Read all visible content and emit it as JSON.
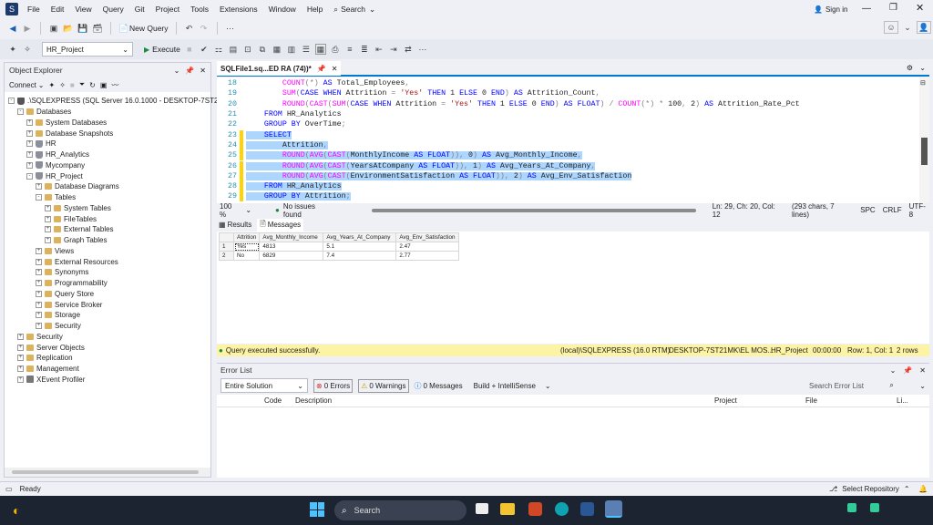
{
  "menu": {
    "items": [
      "File",
      "Edit",
      "View",
      "Query",
      "Git",
      "Project",
      "Tools",
      "Extensions",
      "Window",
      "Help"
    ],
    "search_label": "Search",
    "sign_in": "Sign in"
  },
  "toolbar": {
    "new_query": "New Query",
    "database": "HR_Project",
    "execute": "Execute"
  },
  "object_explorer": {
    "title": "Object Explorer",
    "connect": "Connect",
    "tree": [
      {
        "label": ".\\SQLEXPRESS (SQL Server 16.0.1000 - DESKTOP-7ST21MK",
        "indent": 0,
        "exp": "-",
        "icon": "server"
      },
      {
        "label": "Databases",
        "indent": 1,
        "exp": "-",
        "icon": "folder"
      },
      {
        "label": "System Databases",
        "indent": 2,
        "exp": "+",
        "icon": "folder"
      },
      {
        "label": "Database Snapshots",
        "indent": 2,
        "exp": "+",
        "icon": "folder"
      },
      {
        "label": "HR",
        "indent": 2,
        "exp": "+",
        "icon": "db"
      },
      {
        "label": "HR_Analytics",
        "indent": 2,
        "exp": "+",
        "icon": "db"
      },
      {
        "label": "Mycompany",
        "indent": 2,
        "exp": "+",
        "icon": "db"
      },
      {
        "label": "HR_Project",
        "indent": 2,
        "exp": "-",
        "icon": "db"
      },
      {
        "label": "Database Diagrams",
        "indent": 3,
        "exp": "+",
        "icon": "folder"
      },
      {
        "label": "Tables",
        "indent": 3,
        "exp": "-",
        "icon": "folder"
      },
      {
        "label": "System Tables",
        "indent": 4,
        "exp": "+",
        "icon": "folder"
      },
      {
        "label": "FileTables",
        "indent": 4,
        "exp": "+",
        "icon": "folder"
      },
      {
        "label": "External Tables",
        "indent": 4,
        "exp": "+",
        "icon": "folder"
      },
      {
        "label": "Graph Tables",
        "indent": 4,
        "exp": "+",
        "icon": "folder"
      },
      {
        "label": "Views",
        "indent": 3,
        "exp": "+",
        "icon": "folder"
      },
      {
        "label": "External Resources",
        "indent": 3,
        "exp": "+",
        "icon": "folder"
      },
      {
        "label": "Synonyms",
        "indent": 3,
        "exp": "+",
        "icon": "folder"
      },
      {
        "label": "Programmability",
        "indent": 3,
        "exp": "+",
        "icon": "folder"
      },
      {
        "label": "Query Store",
        "indent": 3,
        "exp": "+",
        "icon": "folder"
      },
      {
        "label": "Service Broker",
        "indent": 3,
        "exp": "+",
        "icon": "folder"
      },
      {
        "label": "Storage",
        "indent": 3,
        "exp": "+",
        "icon": "folder"
      },
      {
        "label": "Security",
        "indent": 3,
        "exp": "+",
        "icon": "folder"
      },
      {
        "label": "Security",
        "indent": 1,
        "exp": "+",
        "icon": "folder"
      },
      {
        "label": "Server Objects",
        "indent": 1,
        "exp": "+",
        "icon": "folder"
      },
      {
        "label": "Replication",
        "indent": 1,
        "exp": "+",
        "icon": "folder"
      },
      {
        "label": "Management",
        "indent": 1,
        "exp": "+",
        "icon": "folder"
      },
      {
        "label": "XEvent Profiler",
        "indent": 1,
        "exp": "+",
        "icon": "xevent"
      }
    ]
  },
  "editor": {
    "tab_title": "SQLFile1.sq...ED RA (74))*",
    "lines": [
      {
        "n": "18",
        "sel": false,
        "html": "        <span class=\"fn\">COUNT</span><span class=\"gy\">(*)</span> <span class=\"kw\">AS</span> Total_Employees<span class=\"gy\">,</span>"
      },
      {
        "n": "19",
        "sel": false,
        "html": "        <span class=\"fn\">SUM</span><span class=\"gy\">(</span><span class=\"kw\">CASE WHEN</span> Attrition <span class=\"gy\">=</span> <span class=\"str\">'Yes'</span> <span class=\"kw\">THEN</span> 1 <span class=\"kw\">ELSE</span> 0 <span class=\"kw\">END</span><span class=\"gy\">)</span> <span class=\"kw\">AS</span> Attrition_Count<span class=\"gy\">,</span>"
      },
      {
        "n": "20",
        "sel": false,
        "html": "        <span class=\"fn\">ROUND</span><span class=\"gy\">(</span><span class=\"fn\">CAST</span><span class=\"gy\">(</span><span class=\"fn\">SUM</span><span class=\"gy\">(</span><span class=\"kw\">CASE WHEN</span> Attrition <span class=\"gy\">=</span> <span class=\"str\">'Yes'</span> <span class=\"kw\">THEN</span> 1 <span class=\"kw\">ELSE</span> 0 <span class=\"kw\">END</span><span class=\"gy\">)</span> <span class=\"kw\">AS FLOAT</span><span class=\"gy\">)</span> <span class=\"gy\">/</span> <span class=\"fn\">COUNT</span><span class=\"gy\">(*)</span> <span class=\"gy\">*</span> 100<span class=\"gy\">,</span> 2<span class=\"gy\">)</span> <span class=\"kw\">AS</span> Attrition_Rate_Pct"
      },
      {
        "n": "21",
        "sel": false,
        "html": "    <span class=\"kw\">FROM</span> HR_Analytics"
      },
      {
        "n": "22",
        "sel": false,
        "html": "    <span class=\"kw\">GROUP BY</span> OverTime<span class=\"gy\">;</span>"
      },
      {
        "n": "23",
        "sel": true,
        "html": "    <span class=\"kw\">SELECT</span>"
      },
      {
        "n": "24",
        "sel": true,
        "html": "        Attrition<span class=\"gy\">,</span>"
      },
      {
        "n": "25",
        "sel": true,
        "html": "        <span class=\"fn\">ROUND</span><span class=\"gy\">(</span><span class=\"fn\">AVG</span><span class=\"gy\">(</span><span class=\"fn\">CAST</span><span class=\"gy\">(</span>MonthlyIncome <span class=\"kw\">AS FLOAT</span><span class=\"gy\">)),</span> 0<span class=\"gy\">)</span> <span class=\"kw\">AS</span> Avg_Monthly_Income<span class=\"gy\">,</span>"
      },
      {
        "n": "26",
        "sel": true,
        "html": "        <span class=\"fn\">ROUND</span><span class=\"gy\">(</span><span class=\"fn\">AVG</span><span class=\"gy\">(</span><span class=\"fn\">CAST</span><span class=\"gy\">(</span>YearsAtCompany <span class=\"kw\">AS FLOAT</span><span class=\"gy\">)),</span> 1<span class=\"gy\">)</span> <span class=\"kw\">AS</span> Avg_Years_At_Company<span class=\"gy\">,</span>"
      },
      {
        "n": "27",
        "sel": true,
        "html": "        <span class=\"fn\">ROUND</span><span class=\"gy\">(</span><span class=\"fn\">AVG</span><span class=\"gy\">(</span><span class=\"fn\">CAST</span><span class=\"gy\">(</span>EnvironmentSatisfaction <span class=\"kw\">AS FLOAT</span><span class=\"gy\">)),</span> 2<span class=\"gy\">)</span> <span class=\"kw\">AS</span> Avg_Env_Satisfaction"
      },
      {
        "n": "28",
        "sel": true,
        "html": "    <span class=\"kw\">FROM</span> HR_Analytics"
      },
      {
        "n": "29",
        "sel": true,
        "html": "    <span class=\"kw\">GROUP BY</span> Attrition<span class=\"gy\">;</span>"
      }
    ],
    "zoom": "100 %",
    "issues": "No issues found",
    "cursor": "Ln: 29, Ch: 20, Col: 12",
    "chars": "(293 chars, 7 lines)",
    "spc": "SPC",
    "crlf": "CRLF",
    "enc": "UTF-8"
  },
  "results": {
    "tab_results": "Results",
    "tab_messages": "Messages",
    "columns": [
      "Attrition",
      "Avg_Monthly_Income",
      "Avg_Years_At_Company",
      "Avg_Env_Satisfaction"
    ],
    "rows": [
      {
        "n": "1",
        "cells": [
          "Yes",
          "4813",
          "5.1",
          "2.47"
        ]
      },
      {
        "n": "2",
        "cells": [
          "No",
          "6829",
          "7.4",
          "2.77"
        ]
      }
    ],
    "status_msg": "Query executed successfully.",
    "server": "(local)\\SQLEXPRESS (16.0 RTM)",
    "machine": "DESKTOP-7ST21MK\\EL MOS...",
    "db": "HR_Project",
    "time": "00:00:00",
    "rowcol": "Row: 1, Col: 1",
    "rows_count": "2 rows"
  },
  "error_list": {
    "title": "Error List",
    "scope": "Entire Solution",
    "errors": "0 Errors",
    "warnings": "0 Warnings",
    "messages": "0 Messages",
    "build": "Build + IntelliSense",
    "search_placeholder": "Search Error List",
    "cols": [
      "Code",
      "Description",
      "Project",
      "File",
      "Li..."
    ]
  },
  "statusbar": {
    "ready": "Ready",
    "repo": "Select Repository"
  },
  "taskbar": {
    "search": "Search"
  },
  "colors": {
    "accent": "#007acc",
    "selection": "#add6ff",
    "status_yellow": "#fcf3a5"
  }
}
